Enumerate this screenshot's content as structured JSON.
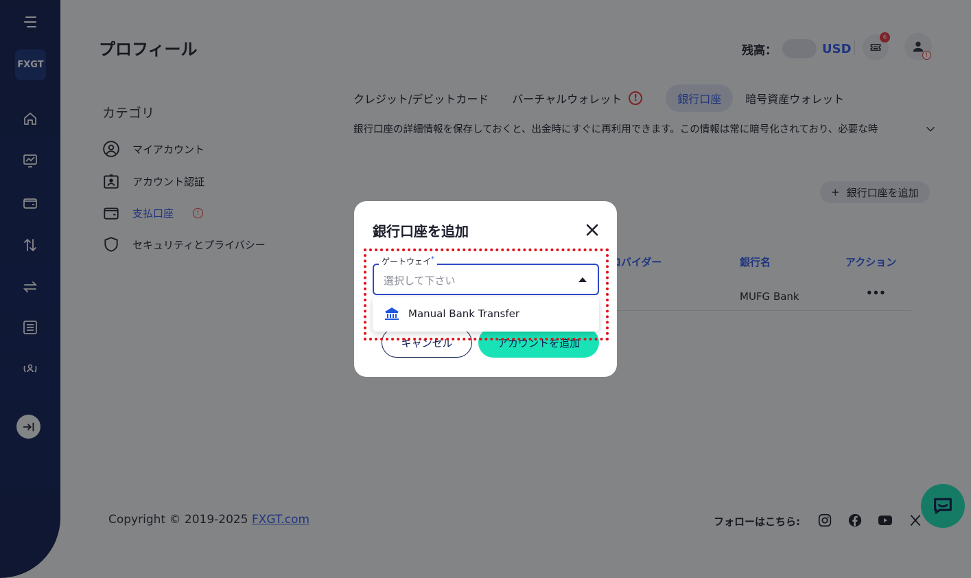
{
  "header": {
    "page_title": "プロフィール",
    "balance_label": "残高：",
    "currency": "USD",
    "notification_count": "6"
  },
  "sidebar": {
    "logo_text": "FXGT",
    "icons": [
      "menu-icon",
      "home-icon",
      "chart-icon",
      "wallet-icon",
      "transfer-icon",
      "exchange-icon",
      "list-icon",
      "partner-icon",
      "collapse-icon"
    ]
  },
  "categories": {
    "title": "カテゴリ",
    "items": [
      {
        "label": "マイアカウント"
      },
      {
        "label": "アカウント認証"
      },
      {
        "label": "支払口座"
      },
      {
        "label": "セキュリティとプライバシー"
      }
    ]
  },
  "tabs": [
    {
      "label": "クレジット/デビットカード"
    },
    {
      "label": "バーチャルウォレット"
    },
    {
      "label": "銀行口座"
    },
    {
      "label": "暗号資産ウォレット"
    }
  ],
  "description": "銀行口座の詳細情報を保存しておくと、出金時にすぐに再利用できます。この情報は常に暗号化されており、必要な時",
  "add_button": "銀行口座を追加",
  "table": {
    "headers": [
      "プロバイダー",
      "銀行名",
      "アクション"
    ],
    "rows": [
      {
        "bank_name": "MUFG Bank",
        "action": "•••"
      }
    ]
  },
  "footer": {
    "copyright": "Copyright © 2019-2025 ",
    "link": "FXGT.com",
    "follow": "フォローはこちら:"
  },
  "modal": {
    "title": "銀行口座を追加",
    "gateway_label": "ゲートウェイ",
    "required_mark": "*",
    "gateway_placeholder": "選択して下さい",
    "option": "Manual Bank Transfer",
    "cancel": "キャンセル",
    "submit": "アカウントを追加"
  },
  "colors": {
    "accent": "#2a56e8",
    "brand_dark": "#0a1a4f",
    "primary_button": "#19e3b6",
    "warning": "#e4323c",
    "highlight": "#e0101a"
  }
}
